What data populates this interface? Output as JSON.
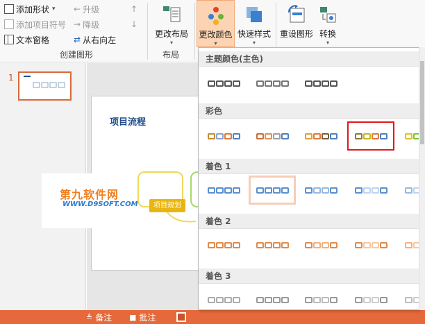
{
  "ribbon": {
    "create_graphic": {
      "add_shape": "添加形状",
      "add_bullet": "添加项目符号",
      "text_pane": "文本窗格",
      "promote": "升级",
      "demote": "降级",
      "right_to_left": "从右向左",
      "group_label": "创建图形"
    },
    "layout": {
      "change_layout": "更改布局",
      "group_label": "布局"
    },
    "change_colors": "更改颜色",
    "quick_styles": "快速样式",
    "reset_graphic": "重设图形",
    "convert": "转换"
  },
  "slide_pane": {
    "slide_number": "1"
  },
  "slide": {
    "title": "项目流程",
    "node_label": "项目规划"
  },
  "watermark": {
    "title": "第九软件网",
    "subtitle": "WWW.D9SOFT.COM"
  },
  "statusbar": {
    "notes": "备注",
    "comments": "批注"
  },
  "gallery": {
    "sections": [
      {
        "header": "主题颜色(主色)",
        "swatches": [
          [
            "#555555",
            "#555555",
            "#555555",
            "#555555"
          ],
          [
            "#777777",
            "#777777",
            "#777777",
            "#777777"
          ],
          [
            "#555555",
            "#555555",
            "#555555",
            "#555555"
          ]
        ]
      },
      {
        "header": "彩色",
        "swatches": [
          [
            "#c58a2e",
            "#8aa4d0",
            "#e07a3a",
            "#4f7fc2"
          ],
          [
            "#c9703a",
            "#e08f5a",
            "#a0a0a0",
            "#4f7fc2"
          ],
          [
            "#e0a030",
            "#e07a3a",
            "#7a5f3a",
            "#4f7fc2"
          ],
          [
            "#8a7a3a",
            "#c8b820",
            "#e07a3a",
            "#4f7fc2"
          ],
          [
            "#e0c020",
            "#7ac63a",
            "#3ab080",
            "#4f7fc2"
          ]
        ]
      },
      {
        "header": "着色 1",
        "swatches": [
          [
            "#5b8fce",
            "#5b8fce",
            "#5b8fce",
            "#5b8fce"
          ],
          [
            "#5b8fce",
            "#5b8fce",
            "#5b8fce",
            "#5b8fce"
          ],
          [
            "#5b8fce",
            "#9ab8e0",
            "#9ab8e0",
            "#5b8fce"
          ],
          [
            "#5b8fce",
            "#c0d4ee",
            "#c0d4ee",
            "#5b8fce"
          ],
          [
            "#9ab8e0",
            "#c0d4ee",
            "#c0d4ee",
            "#9ab8e0"
          ]
        ]
      },
      {
        "header": "着色 2",
        "swatches": [
          [
            "#e08a4a",
            "#e08a4a",
            "#e08a4a",
            "#e08a4a"
          ],
          [
            "#e08a4a",
            "#e08a4a",
            "#e08a4a",
            "#e08a4a"
          ],
          [
            "#e08a4a",
            "#f0b080",
            "#f0b080",
            "#e08a4a"
          ],
          [
            "#e08a4a",
            "#f5c8a0",
            "#f5c8a0",
            "#e08a4a"
          ],
          [
            "#f0b080",
            "#f5c8a0",
            "#f5c8a0",
            "#f0b080"
          ]
        ]
      },
      {
        "header": "着色 3",
        "swatches": [
          [
            "#aaaaaa",
            "#aaaaaa",
            "#aaaaaa",
            "#aaaaaa"
          ],
          [
            "#999999",
            "#999999",
            "#999999",
            "#999999"
          ],
          [
            "#999999",
            "#bbbbbb",
            "#bbbbbb",
            "#999999"
          ],
          [
            "#999999",
            "#cccccc",
            "#cccccc",
            "#999999"
          ],
          [
            "#bbbbbb",
            "#cccccc",
            "#cccccc",
            "#bbbbbb"
          ]
        ]
      }
    ],
    "accent_selected": "#e0181b",
    "accent_hover": "#f5cdb8"
  },
  "colors": {
    "statusbar": "#e5693b",
    "active_button": "#fcd3b3",
    "brand_orange": "#f07f1e",
    "brand_blue": "#2b7bd0"
  }
}
